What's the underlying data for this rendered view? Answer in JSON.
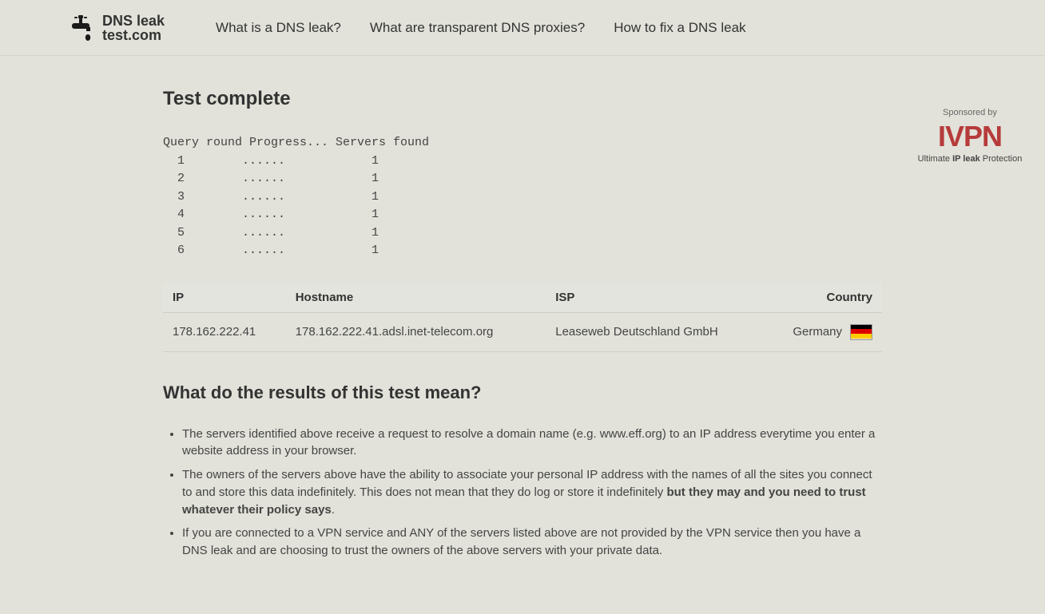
{
  "nav": {
    "logo_line1": "DNS leak",
    "logo_line2": "test.com",
    "items": [
      {
        "label": "What is a DNS leak?"
      },
      {
        "label": "What are transparent DNS proxies?"
      },
      {
        "label": "How to fix a DNS leak"
      }
    ]
  },
  "main": {
    "title": "Test complete",
    "query_header": "Query round Progress... Servers found",
    "query_rows": [
      {
        "round": "1",
        "progress": "......",
        "found": "1"
      },
      {
        "round": "2",
        "progress": "......",
        "found": "1"
      },
      {
        "round": "3",
        "progress": "......",
        "found": "1"
      },
      {
        "round": "4",
        "progress": "......",
        "found": "1"
      },
      {
        "round": "5",
        "progress": "......",
        "found": "1"
      },
      {
        "round": "6",
        "progress": "......",
        "found": "1"
      }
    ]
  },
  "sponsor": {
    "label": "Sponsored by",
    "logo": "IVPN",
    "tagline_pre": "Ultimate ",
    "tagline_bold": "IP leak",
    "tagline_post": " Protection"
  },
  "results": {
    "headers": {
      "ip": "IP",
      "hostname": "Hostname",
      "isp": "ISP",
      "country": "Country"
    },
    "rows": [
      {
        "ip": "178.162.222.41",
        "hostname": "178.162.222.41.adsl.inet-telecom.org",
        "isp": "Leaseweb Deutschland GmbH",
        "country": "Germany",
        "flag": "de"
      }
    ]
  },
  "explain": {
    "title": "What do the results of this test mean?",
    "bullets": [
      {
        "pre": "The servers identified above receive a request to resolve a domain name (e.g. www.eff.org) to an IP address everytime you enter a website address in your browser.",
        "bold": "",
        "post": ""
      },
      {
        "pre": "The owners of the servers above have the ability to associate your personal IP address with the names of all the sites you connect to and store this data indefinitely. This does not mean that they do log or store it indefinitely ",
        "bold": "but they may and you need to trust whatever their policy says",
        "post": "."
      },
      {
        "pre": "If you are connected to a VPN service and ANY of the servers listed above are not provided by the VPN service then you have a DNS leak and are choosing to trust the owners of the above servers with your private data.",
        "bold": "",
        "post": ""
      }
    ]
  }
}
